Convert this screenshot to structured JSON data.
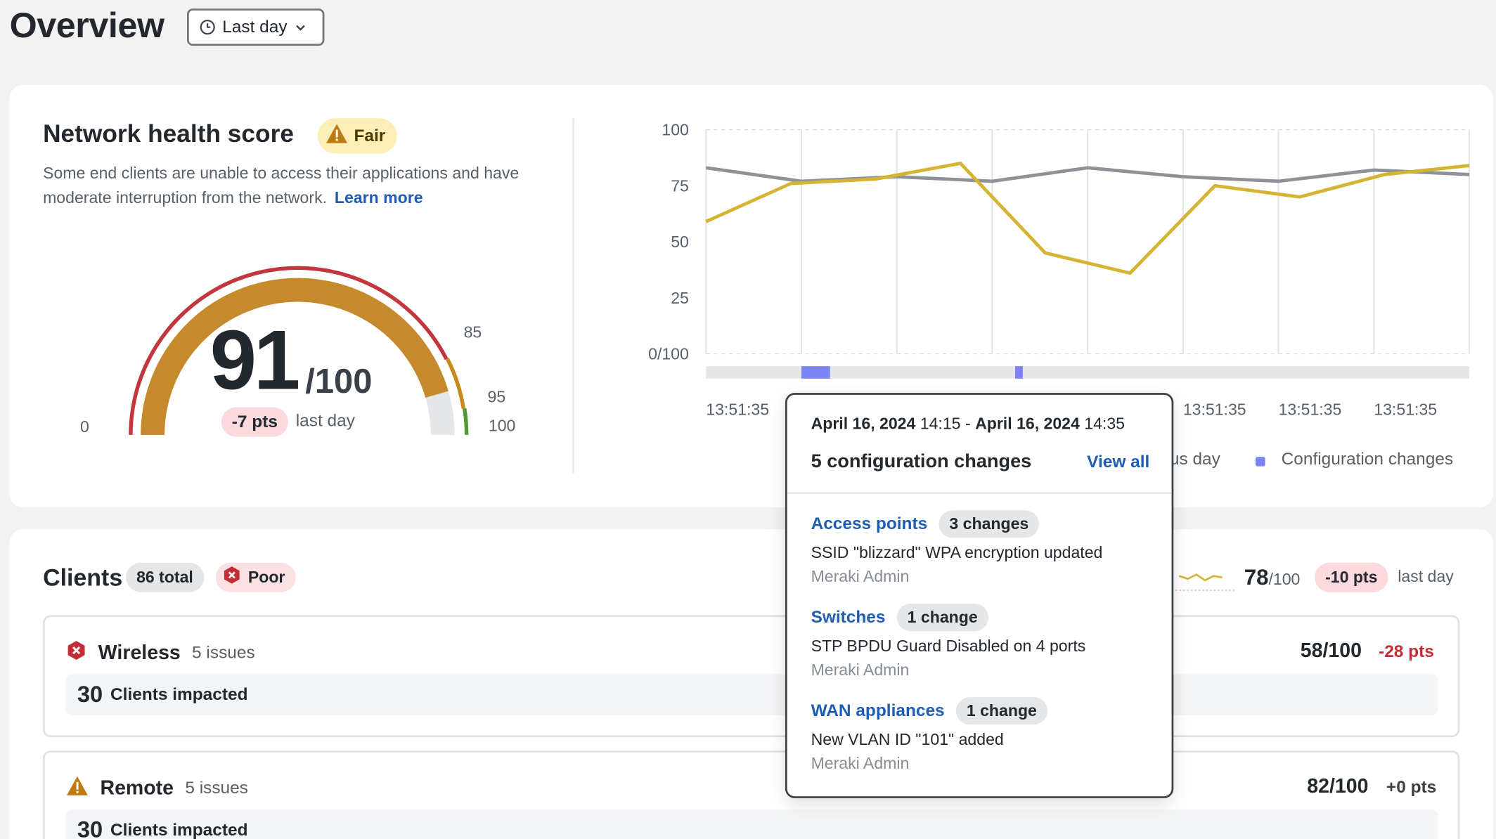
{
  "page": {
    "title": "Overview"
  },
  "range_select": {
    "label": "Last day",
    "icon": "clock-icon"
  },
  "health": {
    "title": "Network health score",
    "status": "Fair",
    "description": "Some end clients are unable to access their applications and have moderate interruption from the network.",
    "learn_more": "Learn more",
    "score": "91",
    "score_max": "/100",
    "change": "-7 pts",
    "change_period": "last day",
    "gauge": {
      "value": 91,
      "labels": {
        "min": "0",
        "t1": "85",
        "t2": "95",
        "max": "100"
      }
    }
  },
  "chart_data": {
    "type": "line",
    "y_ticks": [
      "100",
      "75",
      "50",
      "25",
      "0/100"
    ],
    "ylim": [
      0,
      100
    ],
    "x_ticks": [
      "13:51:35",
      "13:51:35",
      "13:51:35",
      "13:51:35"
    ],
    "series": [
      {
        "color": "#8e9297",
        "values": [
          83,
          77,
          79,
          77,
          83,
          79,
          77,
          82,
          80
        ]
      },
      {
        "color": "#d4b432",
        "values": [
          59,
          76,
          78,
          85,
          45,
          36,
          75,
          70,
          80,
          84
        ]
      }
    ],
    "config_changes_color": "#7b83f6",
    "legend": {
      "partial": "us day",
      "config": "Configuration changes"
    }
  },
  "popover": {
    "date_start": "April 16, 2024",
    "time_start": "14:15",
    "sep": "-",
    "date_end": "April 16, 2024",
    "time_end": "14:35",
    "heading": "5 configuration changes",
    "view_all": "View all",
    "groups": [
      {
        "name": "Access points",
        "count": "3 changes",
        "detail": "SSID \"blizzard\" WPA encryption updated",
        "author": "Meraki Admin"
      },
      {
        "name": "Switches",
        "count": "1 change",
        "detail": "STP BPDU Guard Disabled on 4 ports",
        "author": "Meraki Admin"
      },
      {
        "name": "WAN appliances",
        "count": "1 change",
        "detail": "New VLAN ID \"101\" added",
        "author": "Meraki Admin"
      }
    ]
  },
  "clients": {
    "title": "Clients",
    "total": "86 total",
    "status": "Poor",
    "score": "78",
    "score_max": "/100",
    "change": "-10 pts",
    "change_period": "last day",
    "sparkline": [
      50,
      40,
      55,
      35,
      50,
      45
    ],
    "issues": [
      {
        "name": "Wireless",
        "count": "5 issues",
        "impacted_num": "30",
        "impacted_label": "Clients impacted",
        "score": "58/100",
        "pts": "-28 pts",
        "pts_color": "#c42c36",
        "icon": "error-hexagon-icon"
      },
      {
        "name": "Remote",
        "count": "5 issues",
        "impacted_num": "30",
        "impacted_label": "Clients impacted",
        "score": "82/100",
        "pts": "+0 pts",
        "pts_color": "#3a4048",
        "icon": "warning-triangle-icon"
      }
    ]
  }
}
